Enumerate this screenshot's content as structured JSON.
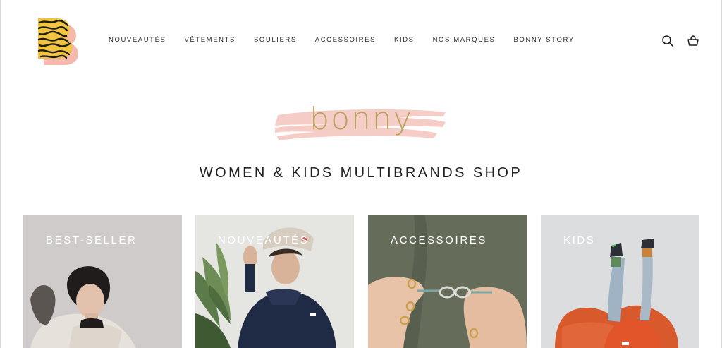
{
  "header": {
    "logo_icon": "bonny-b-logo",
    "nav": [
      {
        "label": "NOUVEAUTÉS"
      },
      {
        "label": "VÊTEMENTS"
      },
      {
        "label": "SOULIERS"
      },
      {
        "label": "ACCESSOIRES"
      },
      {
        "label": "KIDS"
      },
      {
        "label": "NOS MARQUES"
      },
      {
        "label": "BONNY STORY"
      }
    ],
    "icons": [
      "search-icon",
      "cart-icon"
    ]
  },
  "hero": {
    "brand_word": "bonny",
    "tagline": "WOMEN & KIDS MULTIBRANDS SHOP"
  },
  "cards": [
    {
      "label": "BEST-SELLER"
    },
    {
      "label": "NOUVEAUTÉS"
    },
    {
      "label": "ACCESSOIRES"
    },
    {
      "label": "KIDS"
    }
  ],
  "colors": {
    "brand_gold": "#b7a15e",
    "brush_pink": "#f6cdc6",
    "logo_yellow": "#f2c33c",
    "logo_pink": "#f4b8ad"
  }
}
